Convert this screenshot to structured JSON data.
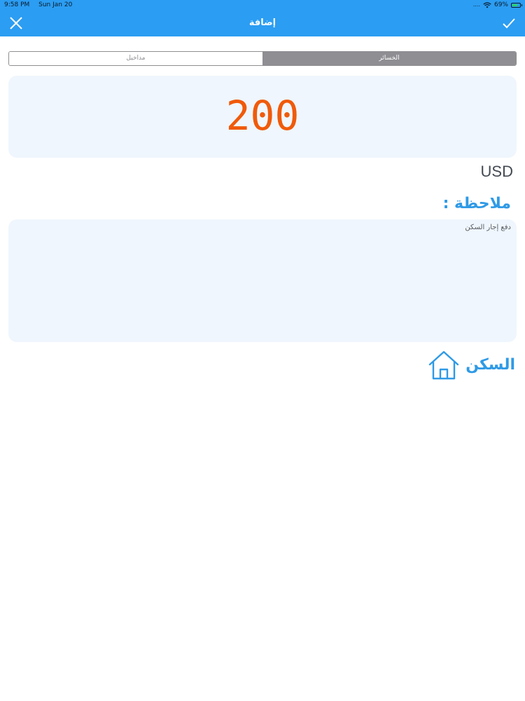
{
  "status_bar": {
    "time": "9:58 PM",
    "date": "Sun Jan 20",
    "battery_text": "69%",
    "battery_level": 0.69,
    "wifi_icon": "wifi-icon",
    "battery_icon": "battery-charging-icon"
  },
  "nav": {
    "title": "إضافة",
    "close_icon": "close-icon",
    "done_icon": "checkmark-icon",
    "background_color": "#2b9df2"
  },
  "segment_control": {
    "options": [
      "الخسائر",
      "مداخيل"
    ],
    "selected_index": 0
  },
  "amount": {
    "value": "200",
    "color": "#f05a0a"
  },
  "currency": "USD",
  "note": {
    "label": "ملاحظة :",
    "text": "دفع إجار السكن"
  },
  "category": {
    "label": "السكن",
    "icon": "home-icon",
    "color": "#2f9ae6"
  }
}
